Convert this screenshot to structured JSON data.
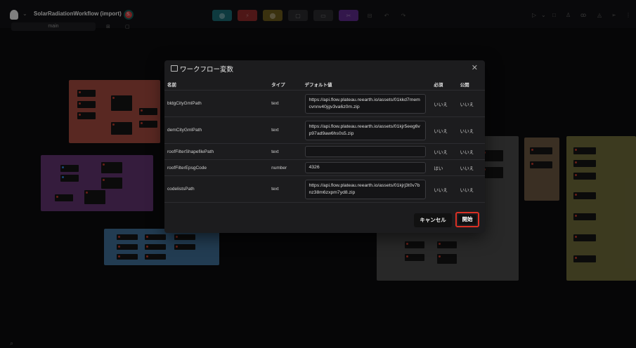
{
  "app": {
    "workflow_title": "SolarRadiationWorkflow (import)",
    "branch": "main",
    "user_initial": "S."
  },
  "toolbar": {
    "tools": [
      {
        "icon": "reader-icon",
        "color": "#1a6b74"
      },
      {
        "icon": "transformer-icon",
        "color": "#8e2b2b"
      },
      {
        "icon": "writer-icon",
        "color": "#6b5a1d"
      },
      {
        "icon": "note-icon",
        "color": "#2a2a2e"
      },
      {
        "icon": "batch-icon",
        "color": "#2a2a2e"
      },
      {
        "icon": "subworkflow-icon",
        "color": "#5e2b8a"
      }
    ]
  },
  "dialog": {
    "title": "ワークフロー変数",
    "columns": [
      "名前",
      "タイプ",
      "デフォルト値",
      "必須",
      "公開"
    ],
    "rows": [
      {
        "name": "bldgCityGmlPath",
        "type": "text",
        "value": "https://api.flow.plateau.reearth.io/assets/01kkd7memcvnnv40jgv3va6z0m.zip",
        "required": "いいえ",
        "public": "いいえ"
      },
      {
        "name": "demCityGmlPath",
        "type": "text",
        "value": "https://api.flow.plateau.reearth.io/assets/01kjr5eeg6vp97ad9aw6hs0s5.zip",
        "required": "いいえ",
        "public": "いいえ"
      },
      {
        "name": "roofFilterShapefilePath",
        "type": "text",
        "value": "",
        "required": "いいえ",
        "public": "いいえ"
      },
      {
        "name": "roofFilterEpsgCode",
        "type": "number",
        "value": "4326",
        "required": "はい",
        "public": "いいえ"
      },
      {
        "name": "codelistsPath",
        "type": "text",
        "value": "https://api.flow.plateau.reearth.io/assets/01kjrj3t0v7bnz38m6zxpm7yd8.zip",
        "required": "いいえ",
        "public": "いいえ"
      }
    ],
    "cancel_label": "キャンセル",
    "start_label": "開始"
  }
}
